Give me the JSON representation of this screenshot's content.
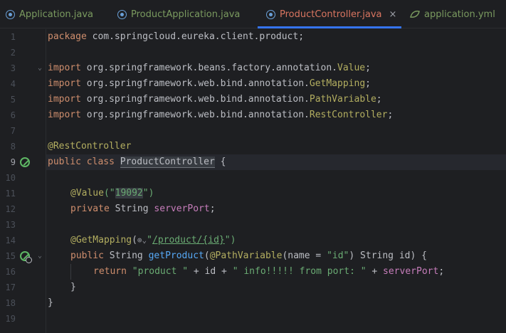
{
  "tabs": [
    {
      "label": "Application.java",
      "icon": "java-class-icon",
      "active": false
    },
    {
      "label": "ProductApplication.java",
      "icon": "java-class-icon",
      "active": false
    },
    {
      "label": "ProductController.java",
      "icon": "java-class-icon",
      "active": true,
      "close": "×"
    },
    {
      "label": "application.yml",
      "icon": "spring-config-icon",
      "active": false
    }
  ],
  "editor": {
    "current_line": 9,
    "line_numbers": [
      "1",
      "2",
      "3",
      "4",
      "5",
      "6",
      "7",
      "8",
      "9",
      "10",
      "11",
      "12",
      "13",
      "14",
      "15",
      "16",
      "17",
      "18",
      "19"
    ],
    "lines": {
      "l1": {
        "kw": "package",
        "rest": " com.springcloud.eureka.client.product;"
      },
      "l3": {
        "kw": "import",
        "pkg": " org.springframework.beans.factory.annotation.",
        "cls": "Value",
        "end": ";"
      },
      "l4": {
        "kw": "import",
        "pkg": " org.springframework.web.bind.annotation.",
        "cls": "GetMapping",
        "end": ";"
      },
      "l5": {
        "kw": "import",
        "pkg": " org.springframework.web.bind.annotation.",
        "cls": "PathVariable",
        "end": ";"
      },
      "l6": {
        "kw": "import",
        "pkg": " org.springframework.web.bind.annotation.",
        "cls": "RestController",
        "end": ";"
      },
      "l8": {
        "ann": "@RestController"
      },
      "l9": {
        "kw1": "public",
        "kw2": "class",
        "name": "ProductController",
        "end": " {"
      },
      "l11": {
        "ann": "@Value",
        "open": "(\"",
        "val": "19092",
        "close": "\")"
      },
      "l12": {
        "kw": "private",
        "type": "String",
        "field": "serverPort",
        "end": ";"
      },
      "l14": {
        "ann": "@GetMapping",
        "open": "(",
        "globe": "⊕",
        "chev": "⌄",
        "q1": "\"",
        "path": "/product/{id}",
        "q2": "\")"
      },
      "l15": {
        "kw": "public",
        "type": "String",
        "fn": "getProduct",
        "open": "(",
        "ann": "@PathVariable",
        "p1": "(name = ",
        "s": "\"id\"",
        "p2": ") String id) {"
      },
      "l16": {
        "kw": "return",
        "s1": "\"product \"",
        "op1": " + id + ",
        "s2": "\" info!!!!! from port: \"",
        "op2": " + ",
        "field": "serverPort",
        "end": ";"
      },
      "l17": {
        "text": "}"
      },
      "l18": {
        "text": "}"
      }
    }
  }
}
